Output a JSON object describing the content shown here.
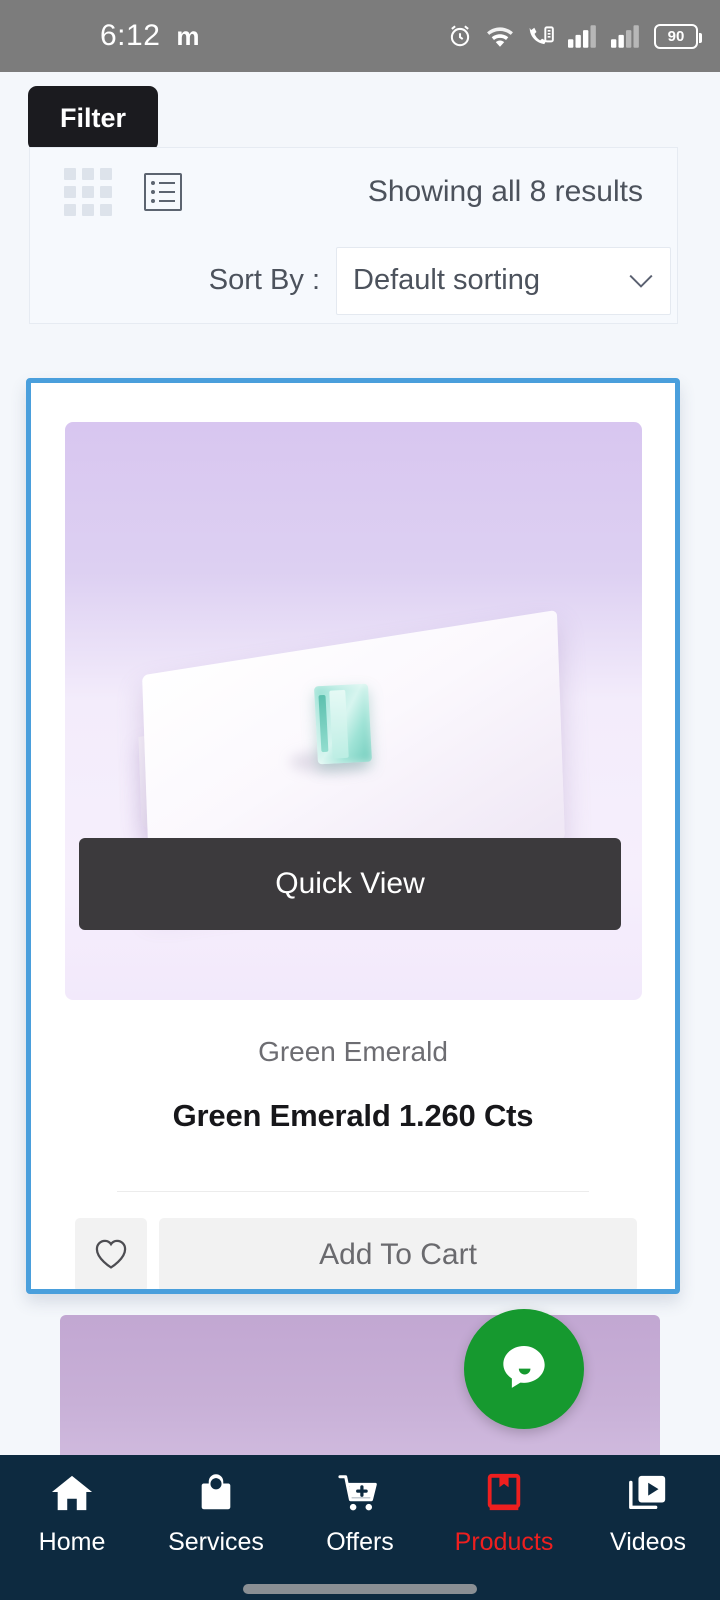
{
  "status_bar": {
    "time": "6:12",
    "carrier_icon_label": "m",
    "icons": [
      "alarm-icon",
      "wifi-icon",
      "vowifi-call-icon",
      "signal-bars-icon",
      "signal-bars-2-icon"
    ],
    "battery_level": "90"
  },
  "toolbar": {
    "filter_label": "Filter",
    "grid_view_icon": "grid-view-icon",
    "list_view_icon": "list-view-icon",
    "results_text": "Showing all 8 results",
    "sort_label": "Sort By :",
    "sort_value": "Default sorting",
    "sort_options": [
      "Default sorting"
    ],
    "chevron_icon": "chevron-down-icon"
  },
  "product": {
    "image_alt": "green-emerald-gemstone-on-white-paper",
    "quick_view_label": "Quick View",
    "category": "Green Emerald",
    "title": "Green Emerald 1.260 Cts",
    "wishlist_icon": "heart-icon",
    "add_to_cart_label": "Add To Cart"
  },
  "chat": {
    "icon": "chat-bubble-icon"
  },
  "bottom_nav": {
    "items": [
      {
        "label": "Home",
        "icon": "home-icon",
        "active": false
      },
      {
        "label": "Services",
        "icon": "shopping-bag-icon",
        "active": false
      },
      {
        "label": "Offers",
        "icon": "cart-plus-icon",
        "active": false
      },
      {
        "label": "Products",
        "icon": "book-icon",
        "active": true
      },
      {
        "label": "Videos",
        "icon": "video-play-icon",
        "active": false
      }
    ]
  },
  "colors": {
    "status_bar_bg": "#7c7c7c",
    "page_bg": "#f4f7fb",
    "filter_bg": "#1b1b1f",
    "card_border": "#4a9fdc",
    "quick_view_bg": "#3c3a3d",
    "chat_fab_bg": "#16992f",
    "nav_bg": "#0d2a40",
    "nav_active": "#ee1f1f"
  }
}
